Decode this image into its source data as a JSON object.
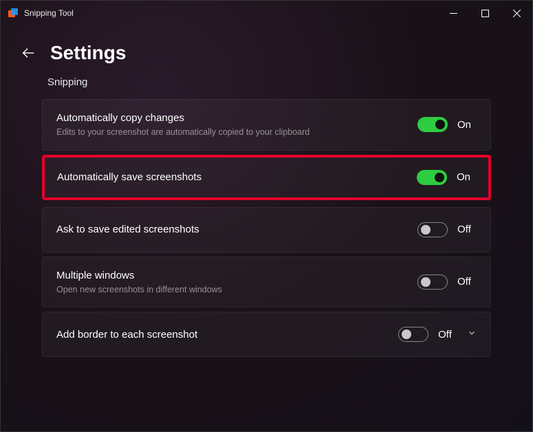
{
  "titlebar": {
    "title": "Snipping Tool"
  },
  "header": {
    "title": "Settings"
  },
  "section": {
    "label": "Snipping"
  },
  "settings": [
    {
      "title": "Automatically copy changes",
      "desc": "Edits to your screenshot are automatically copied to your clipboard",
      "state": "On",
      "on": true,
      "highlighted": false,
      "expandable": false
    },
    {
      "title": "Automatically save screenshots",
      "desc": "",
      "state": "On",
      "on": true,
      "highlighted": true,
      "expandable": false
    },
    {
      "title": "Ask to save edited screenshots",
      "desc": "",
      "state": "Off",
      "on": false,
      "highlighted": false,
      "expandable": false
    },
    {
      "title": "Multiple windows",
      "desc": "Open new screenshots in different windows",
      "state": "Off",
      "on": false,
      "highlighted": false,
      "expandable": false
    },
    {
      "title": "Add border to each screenshot",
      "desc": "",
      "state": "Off",
      "on": false,
      "highlighted": false,
      "expandable": true
    }
  ]
}
